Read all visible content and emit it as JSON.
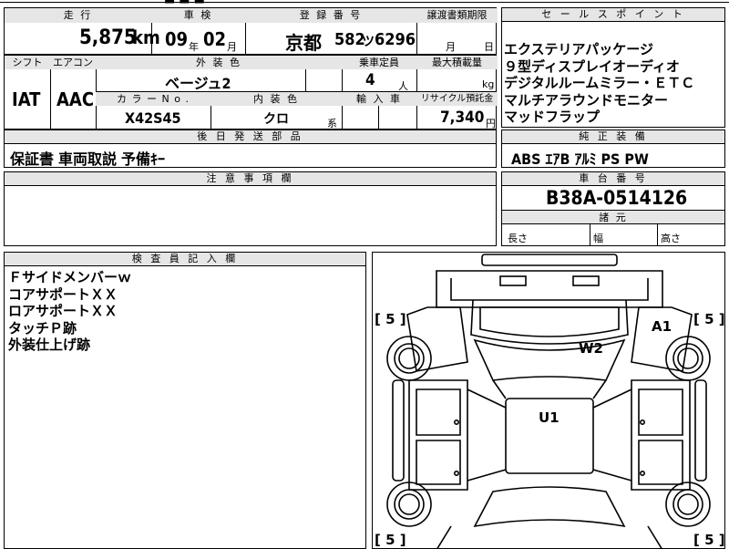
{
  "top_table": {
    "mileage_header": "走 行",
    "mileage_value": "5,875",
    "mileage_unit": "km",
    "inspection_header": "車 検",
    "inspection_year": "09",
    "inspection_year_unit": "年",
    "inspection_month": "02",
    "inspection_month_unit": "月",
    "registration_header": "登 録 番 号",
    "registration_region": "京都",
    "registration_class": "582",
    "registration_kana": "ツ",
    "registration_number": "6296",
    "transfer_header": "譲渡書類期限",
    "transfer_month_unit": "月",
    "transfer_day_unit": "日"
  },
  "second_table": {
    "shift_header": "シフト",
    "shift_value": "IAT",
    "ac_header": "エアコン",
    "ac_value": "AAC",
    "exterior_color_header": "外 装 色",
    "exterior_color_value": "ベージュ2",
    "capacity_header": "乗車定員",
    "capacity_value": "4",
    "capacity_unit": "人",
    "max_load_header": "最大積載量",
    "max_load_unit": "kg",
    "color_no_header": "カ ラ ー N o .",
    "color_no_value": "X42S45",
    "interior_color_header": "内 装 色",
    "interior_color_value": "クロ",
    "interior_color_suffix": "系",
    "import_header": "輸 入 車",
    "recycle_header": "リサイクル預託金",
    "recycle_value": "7,340",
    "recycle_unit": "円"
  },
  "later_items": {
    "header": "後 日 発 送 部 品",
    "value": "保証書  車両取説  予備ｷｰ"
  },
  "notes": {
    "header": "注 意 事 項 欄"
  },
  "sales_points": {
    "header": "セ ー ル ス ポ イ ン ト",
    "items": [
      "エクステリアパッケージ",
      "９型ディスプレイオーディオ",
      "デジタルルームミラー・ＥＴＣ",
      "マルチアラウンドモニター",
      "マッドフラップ"
    ]
  },
  "genuine_equipment": {
    "header": "純 正 装 備",
    "value": "ABS  ｴｱB  ｱﾙﾐ  PS  PW"
  },
  "chassis": {
    "header": "車 台 番 号",
    "value": "B38A-0514126"
  },
  "dimensions": {
    "header": "諸 元",
    "length_label": "長さ",
    "width_label": "幅",
    "height_label": "高さ"
  },
  "inspector": {
    "header": "検 査 員 記 入 欄",
    "lines": [
      "Ｆサイドメンバーｗ",
      "コアサポートＸＸ",
      "ロアサポートＸＸ",
      "タッチＰ跡",
      "外装仕上げ跡"
    ]
  },
  "diagram": {
    "tire_top_left": "5",
    "tire_top_right": "5",
    "tire_bottom_left": "5",
    "tire_bottom_right": "5",
    "mark_a1": "A1",
    "mark_w2": "W2",
    "mark_u1": "U1"
  }
}
